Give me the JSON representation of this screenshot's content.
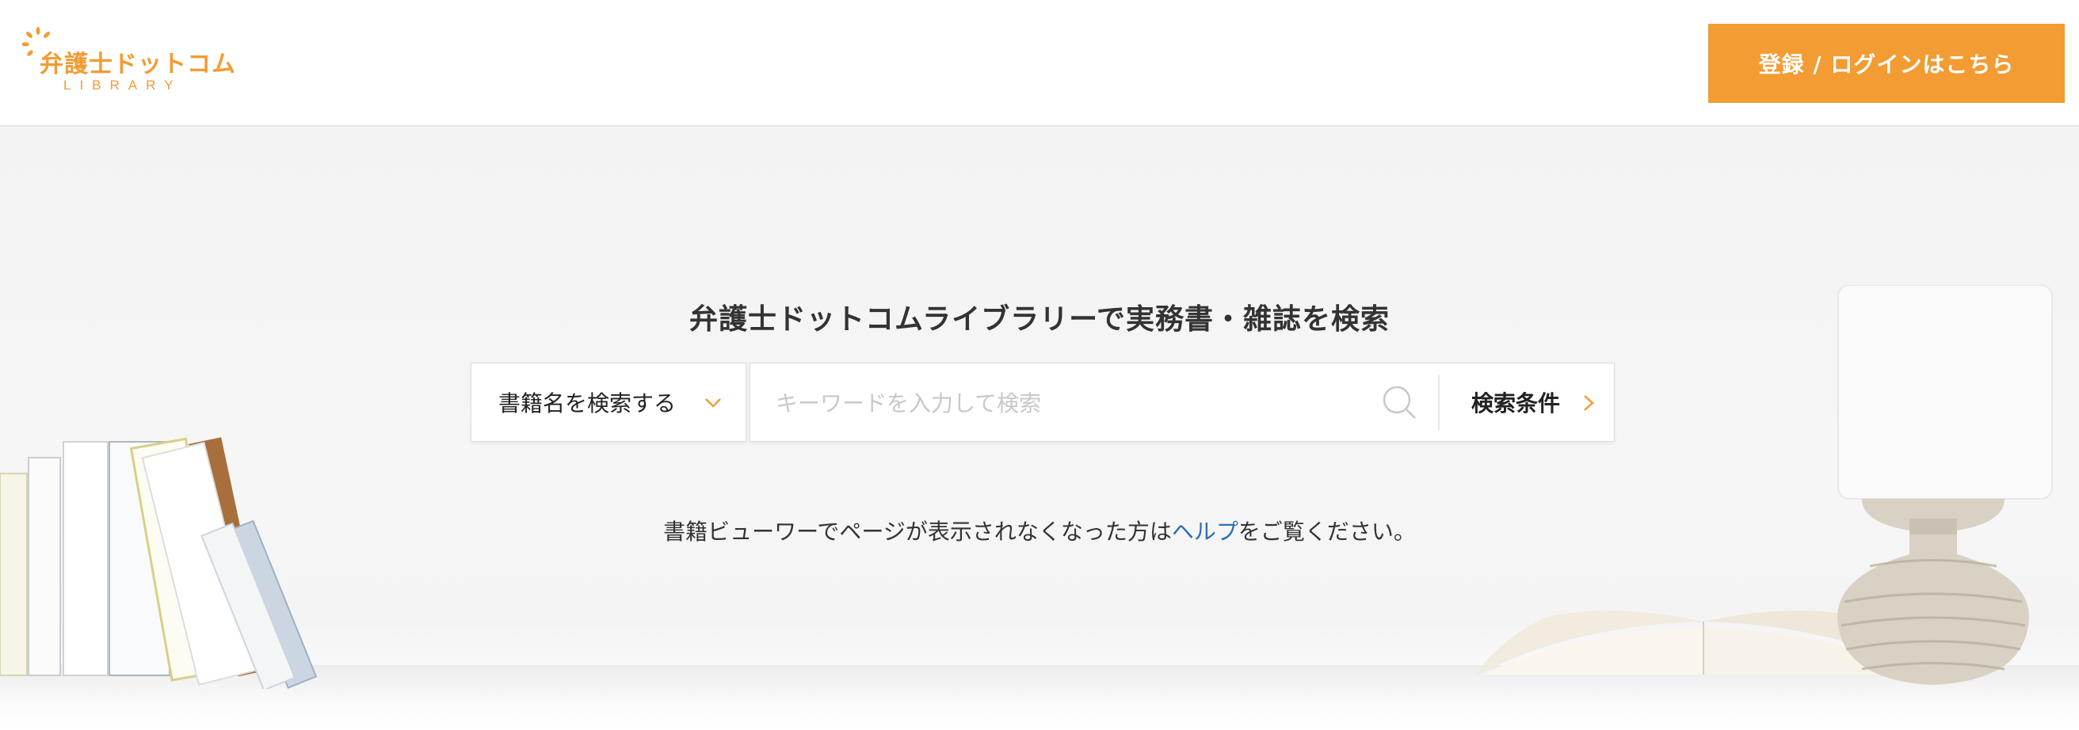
{
  "header": {
    "logo_title": "弁護士ドットコム",
    "logo_subtitle": "LIBRARY",
    "login_label": "登録 / ログインはこちら"
  },
  "hero": {
    "title": "弁護士ドットコムライブラリーで実務書・雑誌を検索",
    "search": {
      "scope_label": "書籍名を検索する",
      "placeholder": "キーワードを入力して検索",
      "conditions_label": "検索条件"
    },
    "help": {
      "prefix": "書籍ビューワーでページが表示されなくなった方は",
      "link": "ヘルプ",
      "suffix": "をご覧ください。"
    }
  },
  "icons": {
    "logo": "sun-logo-icon",
    "scope_toggle": "chevron-down-icon",
    "search": "search-icon",
    "conditions": "chevron-right-icon"
  },
  "colors": {
    "accent": "#f29c33",
    "link": "#2d6db5",
    "text": "#333333"
  }
}
